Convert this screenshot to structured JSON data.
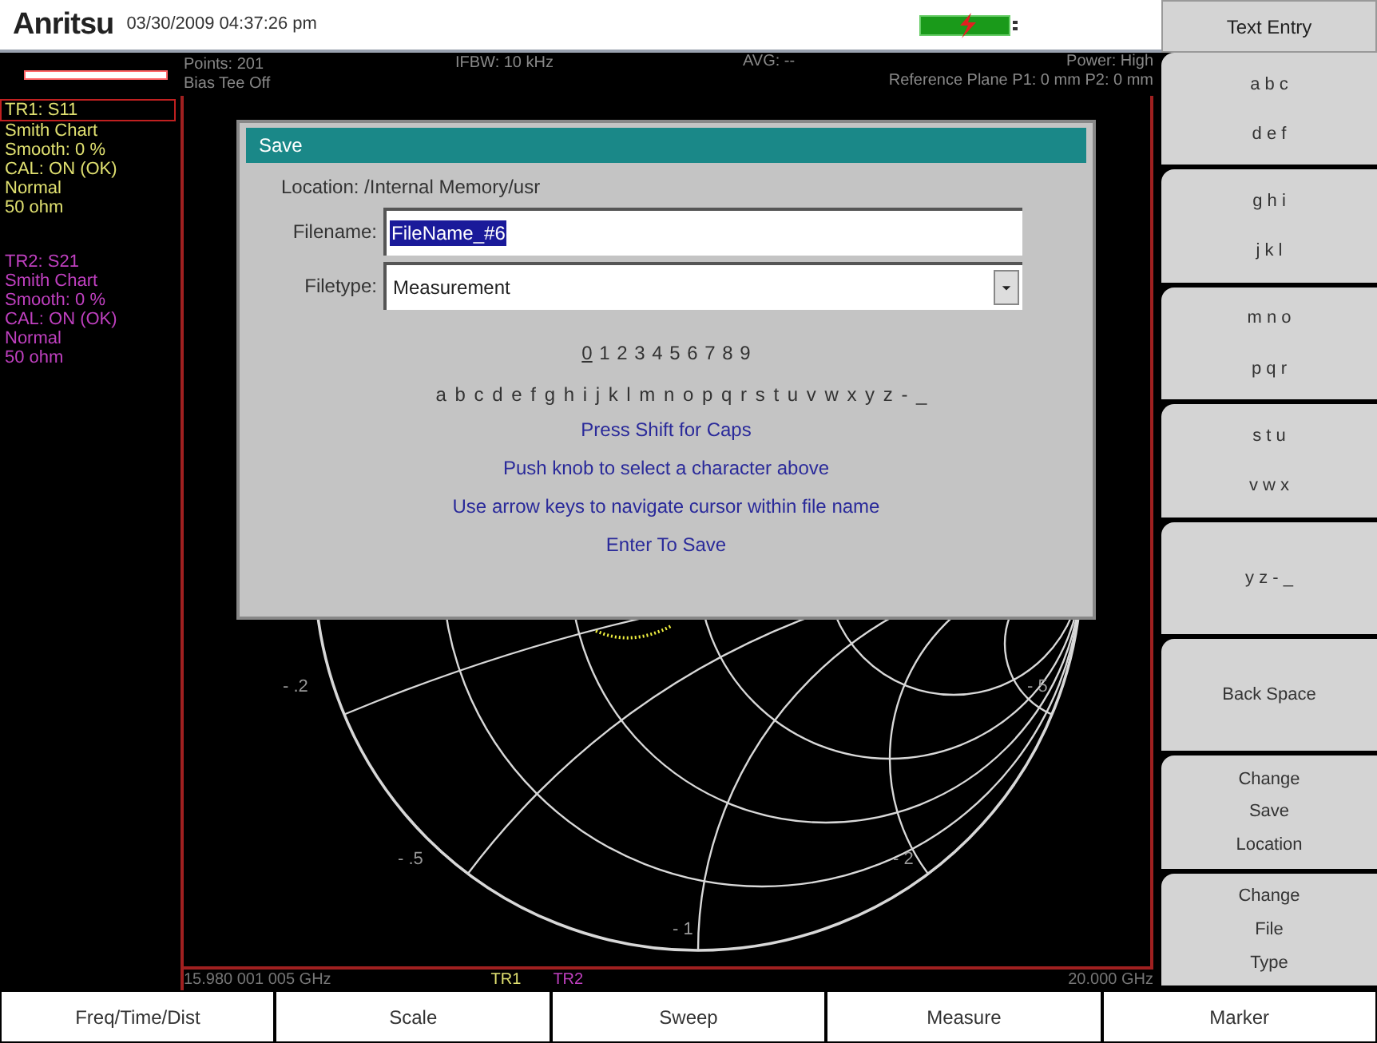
{
  "header": {
    "logo": "Anritsu",
    "datetime": "03/30/2009 04:37:26 pm",
    "battery_charging": true
  },
  "info": {
    "points": "Points: 201",
    "bias_tee": "Bias Tee Off",
    "ifbw": "IFBW: 10 kHz",
    "avg": "AVG: --",
    "power": "Power: High",
    "reference_plane": "Reference Plane P1: 0 mm P2: 0 mm"
  },
  "traces": [
    {
      "title": "TR1: S11",
      "selected": true,
      "color": "#e0e070",
      "lines": [
        "Smith Chart",
        "Smooth: 0 %",
        "CAL: ON (OK)",
        "Normal",
        "50 ohm"
      ]
    },
    {
      "title": "TR2: S21",
      "selected": false,
      "color": "#c040c0",
      "lines": [
        "Smith Chart",
        "Smooth: 0 %",
        "CAL: ON (OK)",
        "Normal",
        "50 ohm"
      ]
    }
  ],
  "chart_labels": [
    "- .2",
    "- .5",
    "- 1",
    "- 2",
    "- 5"
  ],
  "graph_footer": {
    "start": "15.980 001 005 GHz",
    "trace_labels": [
      {
        "label": "TR1",
        "color": "#e0e070"
      },
      {
        "label": "TR2",
        "color": "#c040c0"
      }
    ],
    "stop": "20.000 GHz"
  },
  "dialog": {
    "title": "Save",
    "location": "Location: /Internal Memory/usr",
    "filename_label": "Filename:",
    "filename": "FileName_#6",
    "filetype_label": "Filetype:",
    "filetype": "Measurement",
    "digits": [
      {
        "char": "0",
        "selected": true
      },
      {
        "char": "1",
        "selected": false
      },
      {
        "char": "2",
        "selected": false
      },
      {
        "char": "3",
        "selected": false
      },
      {
        "char": "4",
        "selected": false
      },
      {
        "char": "5",
        "selected": false
      },
      {
        "char": "6",
        "selected": false
      },
      {
        "char": "7",
        "selected": false
      },
      {
        "char": "8",
        "selected": false
      },
      {
        "char": "9",
        "selected": false
      }
    ],
    "letters": "a b c d e f g h i j k l m n o p q r s t u v w x y z - _",
    "instructions": [
      "Press Shift for Caps",
      "Push knob to select a character above",
      "Use arrow keys to navigate cursor within file name",
      "Enter To Save"
    ]
  },
  "softkeys": {
    "title": "Text Entry",
    "keys": [
      {
        "lines": [
          "a b c",
          "d e f"
        ]
      },
      {
        "lines": [
          "g h i",
          "j k l"
        ]
      },
      {
        "lines": [
          "m n o",
          "p q r"
        ]
      },
      {
        "lines": [
          "s t u",
          "v w x"
        ]
      },
      {
        "lines": [
          "y z - _"
        ]
      },
      {
        "lines": [
          "Back Space"
        ]
      },
      {
        "lines": [
          "Change",
          "Save",
          "Location"
        ]
      },
      {
        "lines": [
          "Change",
          "File",
          "Type"
        ]
      }
    ]
  },
  "menu": [
    "Freq/Time/Dist",
    "Scale",
    "Sweep",
    "Measure",
    "Marker"
  ]
}
